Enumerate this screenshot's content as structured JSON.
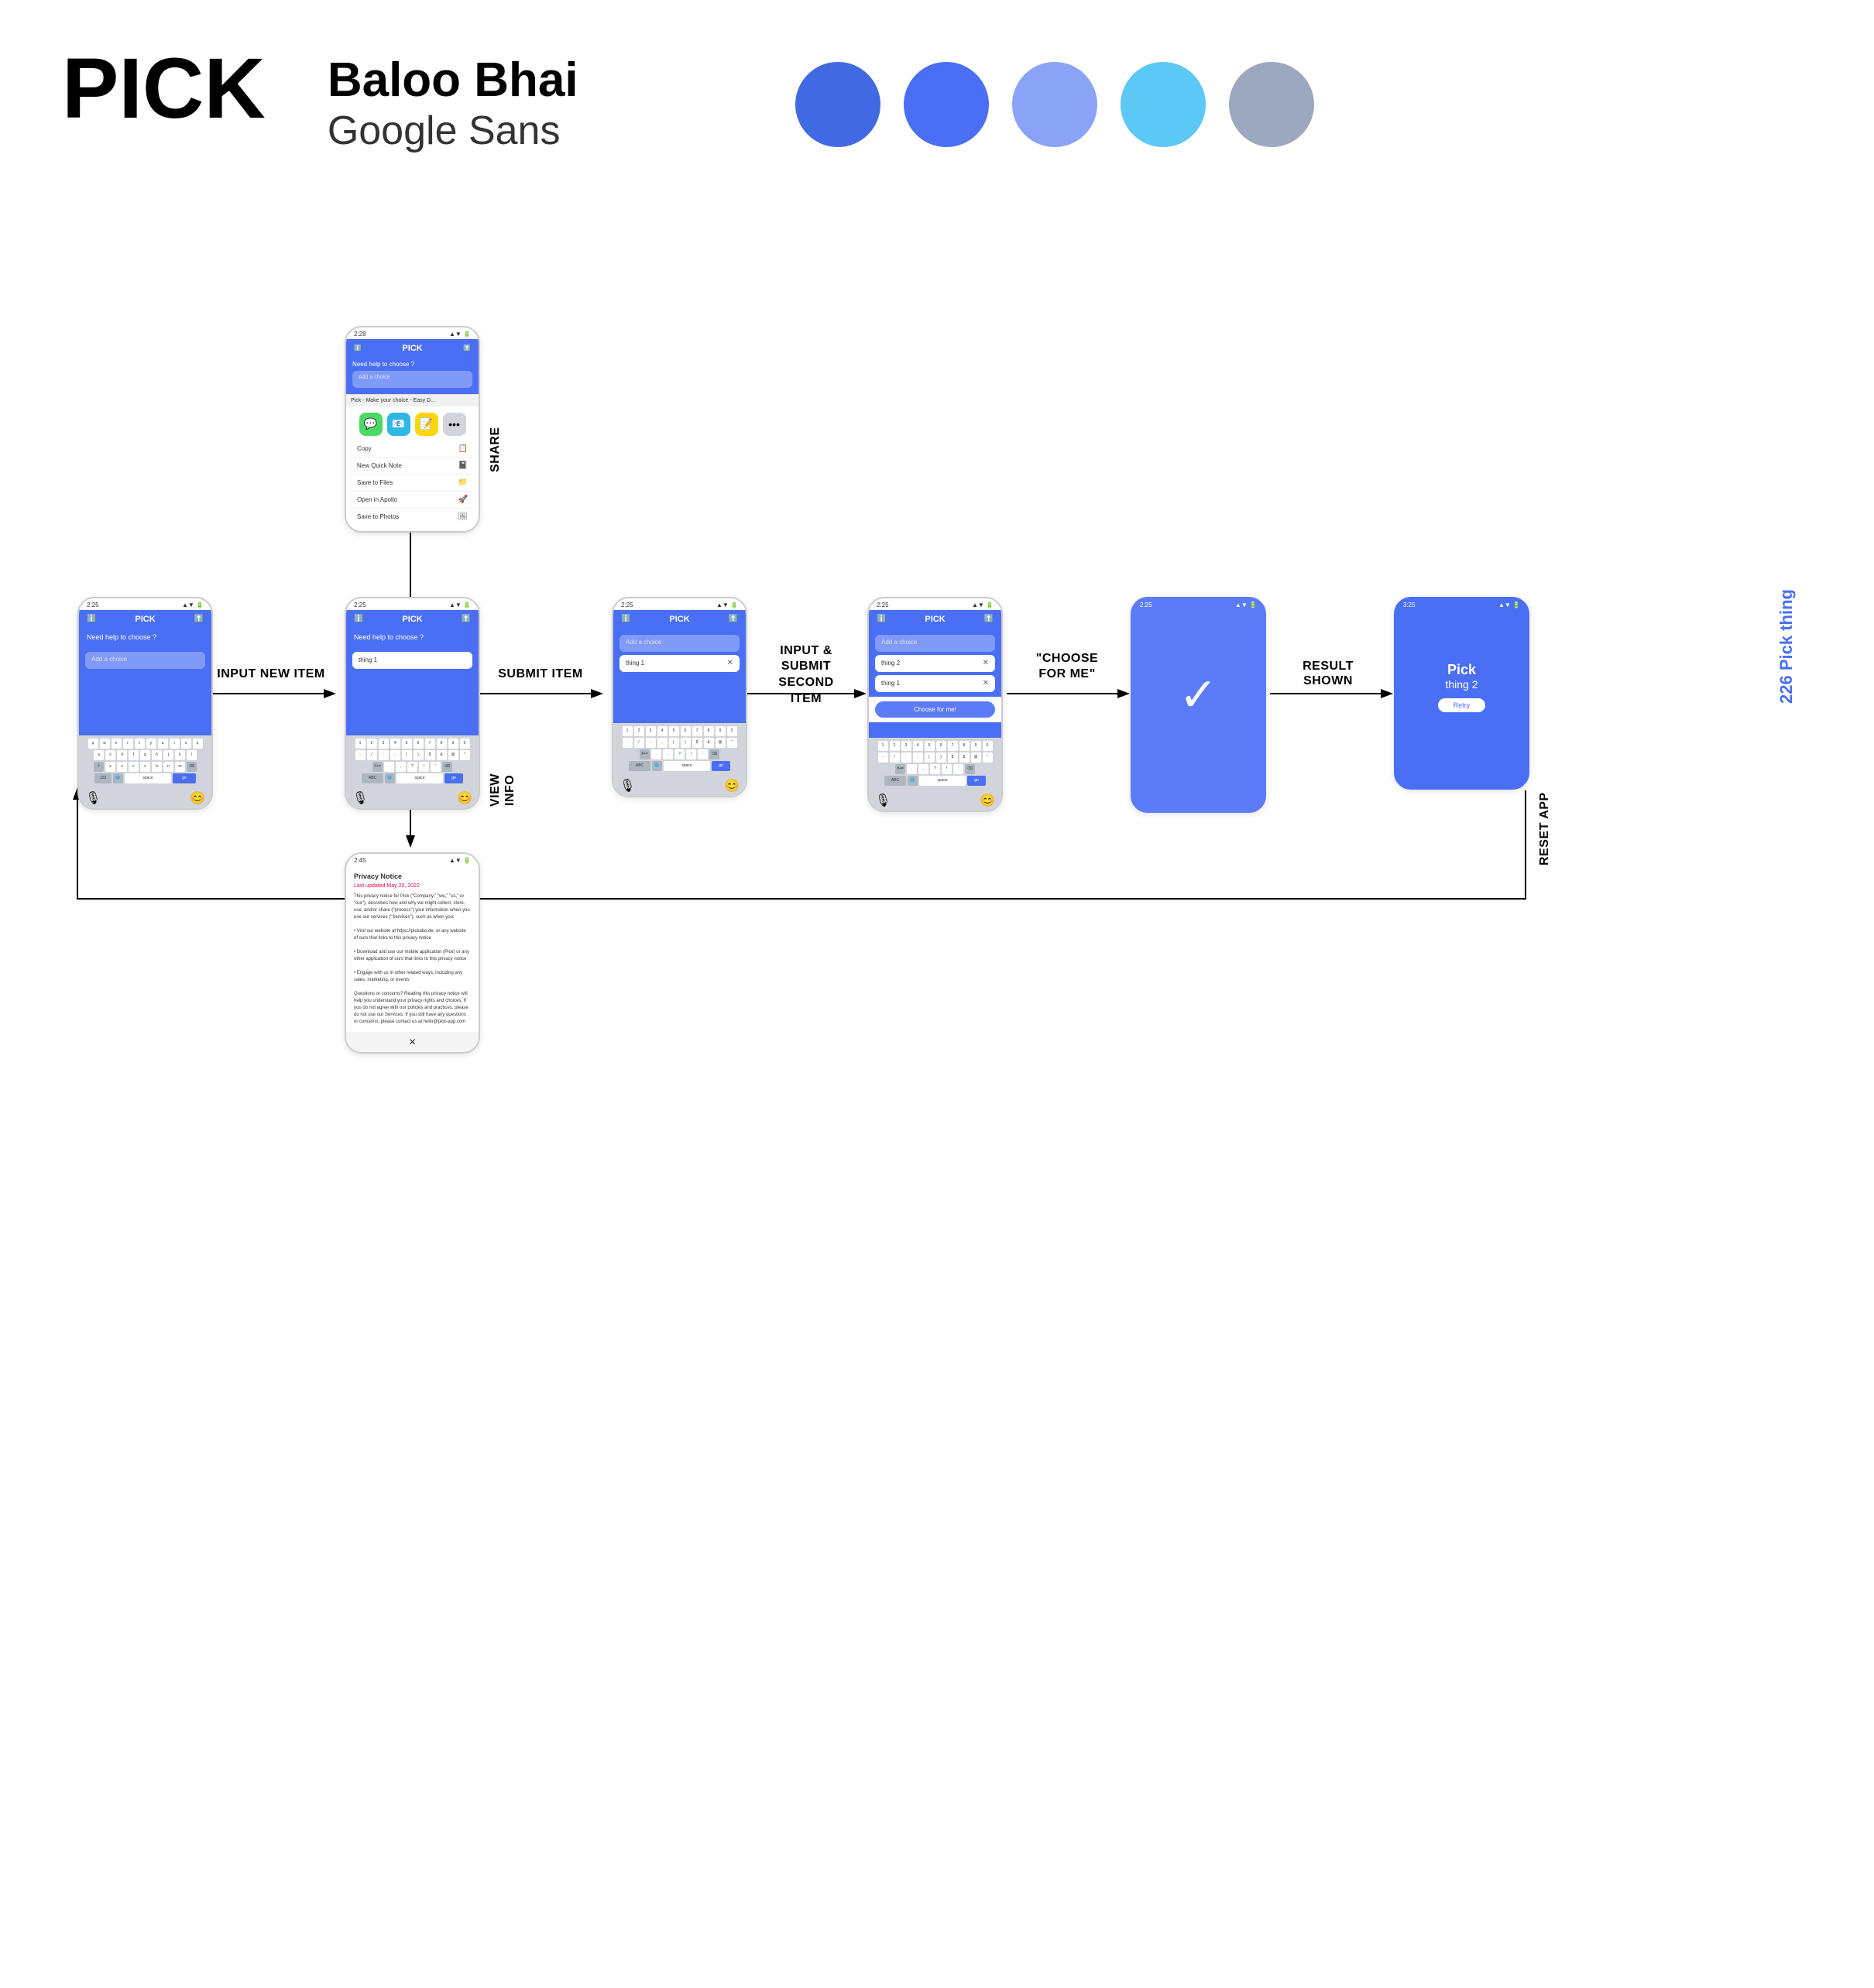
{
  "header": {
    "app_title": "PICK",
    "font_primary": "Baloo Bhai",
    "font_secondary": "Google Sans"
  },
  "colors": [
    {
      "name": "blue-primary",
      "hex": "#4169e1"
    },
    {
      "name": "blue-medium",
      "hex": "#4a6ff5"
    },
    {
      "name": "blue-light",
      "hex": "#8ba3f7"
    },
    {
      "name": "cyan",
      "hex": "#5bc8f5"
    },
    {
      "name": "gray-blue",
      "hex": "#9ba8c0"
    }
  ],
  "flow_labels": {
    "input_new_item": "INPUT NEW ITEM",
    "submit_item": "SUBMIT ITEM",
    "input_submit_second": "INPUT &\nSUBMIT\nSECOND\nITEM",
    "choose_for_me": "\"CHOOSE\nFOR ME\"",
    "result_shown": "RESULT\nSHOWN",
    "reset_app": "RESET APP",
    "share": "SHARE",
    "view_info": "VIEW INFO"
  },
  "screens": {
    "screen1": {
      "title": "PICK",
      "subtitle": "Need help to choose ?",
      "input_placeholder": "Add a choice"
    },
    "screen2": {
      "title": "PICK",
      "subtitle": "Need help to choose ?",
      "item": "thing 1"
    },
    "screen3": {
      "title": "PICK",
      "item": "thing 1"
    },
    "screen4": {
      "title": "PICK",
      "item1": "thing 2",
      "item2": "thing 1"
    },
    "screen5": {
      "checkmark": "✓"
    },
    "screen6": {
      "title": "Pick",
      "result": "thing 2",
      "retry": "Retry"
    },
    "share_screen": {
      "title": "PICK",
      "subtitle": "Need help to choose ?",
      "input_placeholder": "Add a choice",
      "actions": [
        "Copy",
        "New Quick Note",
        "Save to Files",
        "Open in Apollo",
        "Save to Photos"
      ]
    },
    "privacy": {
      "title": "Privacy Notice",
      "updated": "Last updated May 20, 2022"
    }
  },
  "pick_thing_label": "226 Pick thing"
}
